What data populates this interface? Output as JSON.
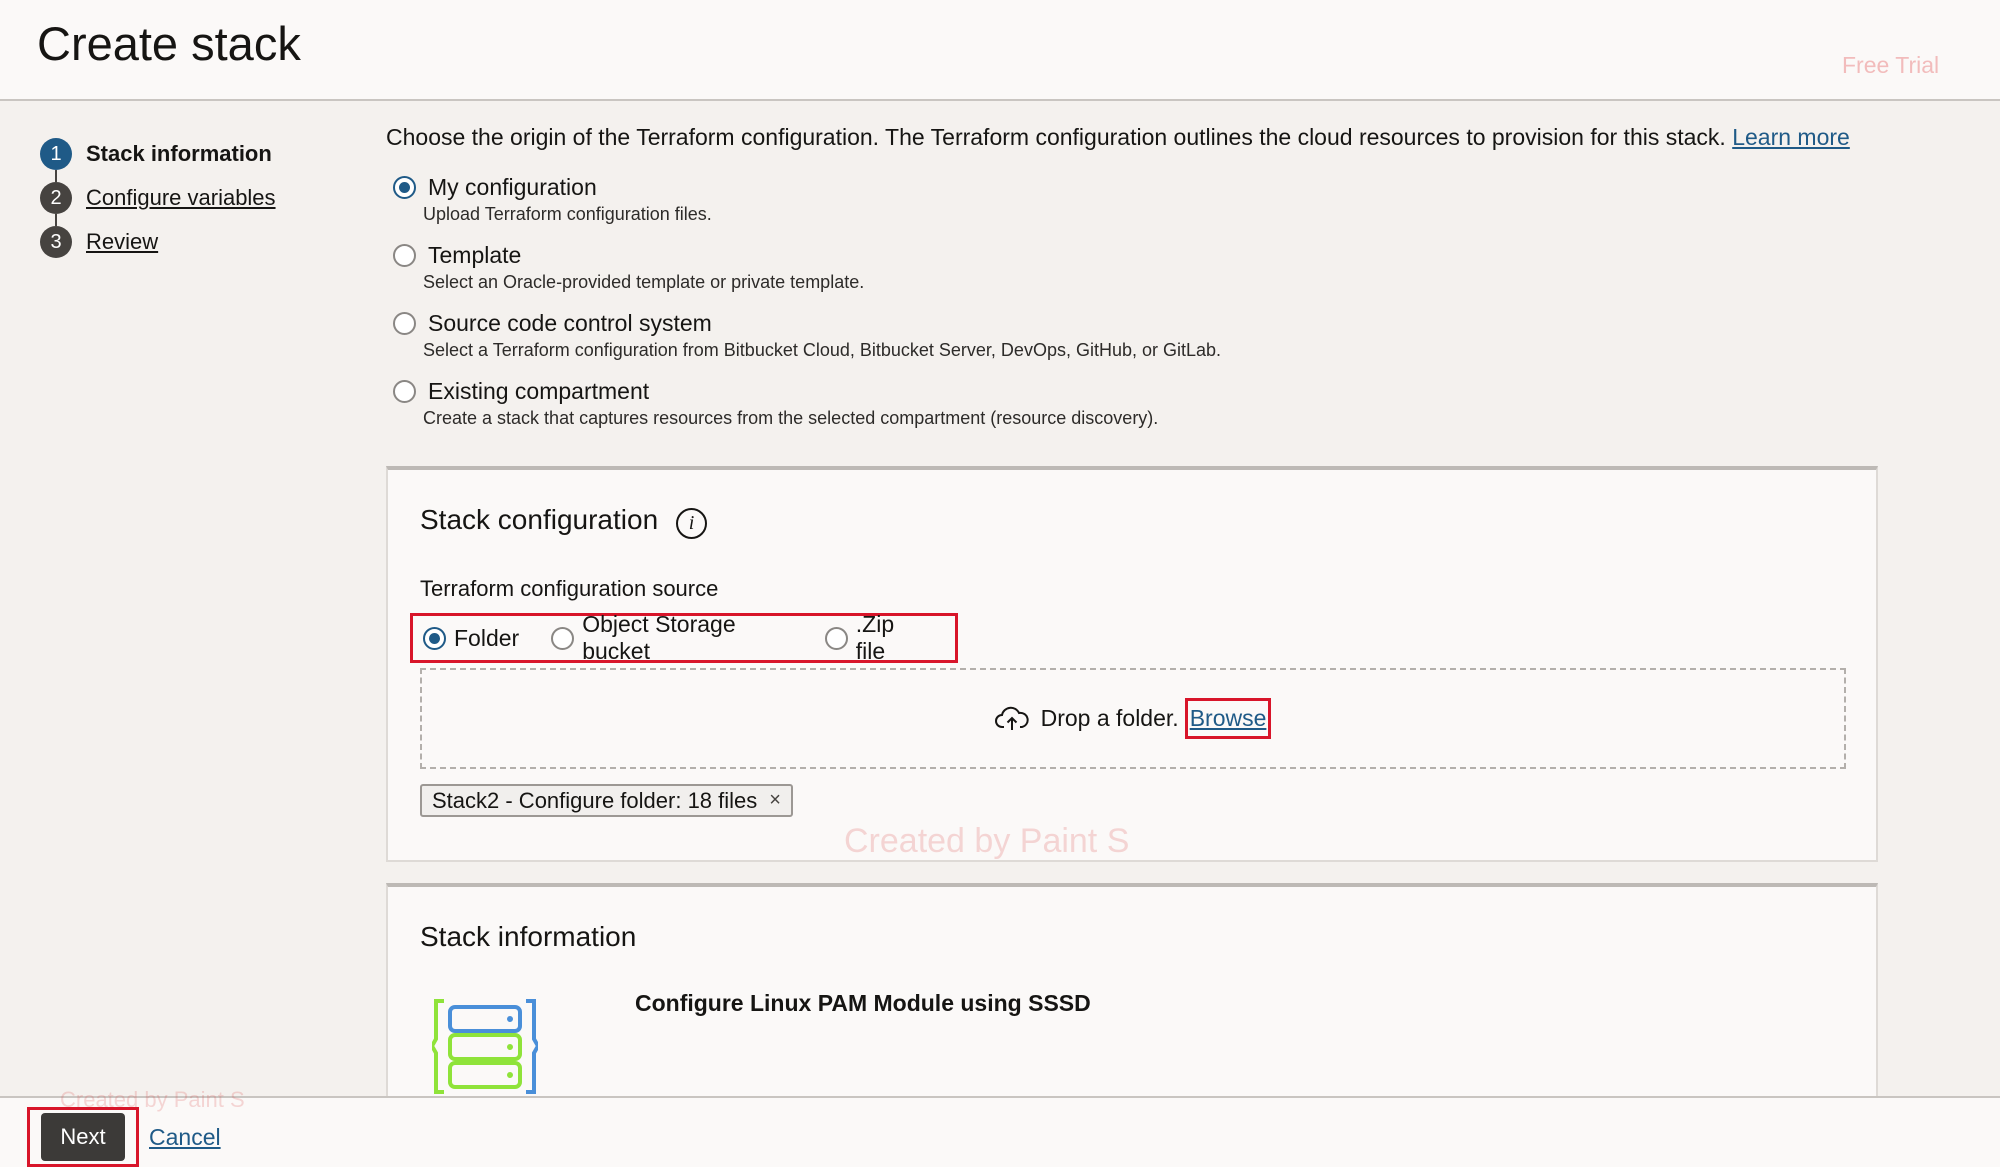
{
  "header": {
    "title": "Create stack",
    "badge": "Free Trial"
  },
  "steps": [
    {
      "number": "1",
      "label": "Stack information",
      "active": true
    },
    {
      "number": "2",
      "label": "Configure variables",
      "active": false
    },
    {
      "number": "3",
      "label": "Review",
      "active": false
    }
  ],
  "origin": {
    "intro": "Choose the origin of the Terraform configuration. The Terraform configuration outlines the cloud resources to provision for this stack.",
    "learn_more": "Learn more",
    "options": [
      {
        "label": "My configuration",
        "description": "Upload Terraform configuration files.",
        "selected": true
      },
      {
        "label": "Template",
        "description": "Select an Oracle-provided template or private template.",
        "selected": false
      },
      {
        "label": "Source code control system",
        "description": "Select a Terraform configuration from Bitbucket Cloud, Bitbucket Server, DevOps, GitHub, or GitLab.",
        "selected": false
      },
      {
        "label": "Existing compartment",
        "description": "Create a stack that captures resources from the selected compartment (resource discovery).",
        "selected": false
      }
    ]
  },
  "stack_configuration": {
    "title": "Stack configuration",
    "info_icon": "i",
    "source_label": "Terraform configuration source",
    "source_options": [
      {
        "label": "Folder",
        "selected": true
      },
      {
        "label": "Object Storage bucket",
        "selected": false
      },
      {
        "label": ".Zip file",
        "selected": false
      }
    ],
    "drop_text": "Drop a folder.",
    "browse_label": "Browse",
    "uploaded_chip": "Stack2 - Configure folder: 18 files",
    "chip_remove": "×"
  },
  "stack_information": {
    "title": "Stack information",
    "stack_name": "Configure Linux PAM Module using SSSD"
  },
  "watermark": {
    "text_1": "Created by Paint S",
    "text_2": "Created by Paint S"
  },
  "footer": {
    "next_label": "Next",
    "cancel_label": "Cancel"
  },
  "colors": {
    "accent": "#1f5a87",
    "highlight": "#d8152a",
    "stack_icon": "#8fe33a"
  }
}
